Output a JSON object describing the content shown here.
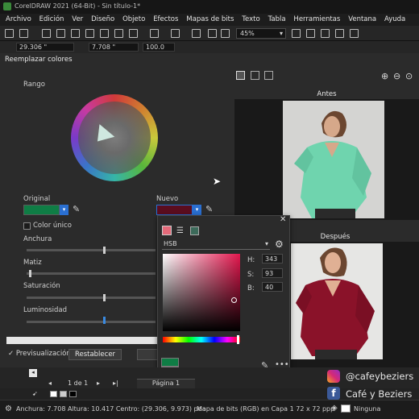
{
  "app": {
    "title": "CorelDRAW 2021 (64-Bit) - Sin título-1*"
  },
  "menu": [
    "Archivo",
    "Edición",
    "Ver",
    "Diseño",
    "Objeto",
    "Efectos",
    "Mapas de bits",
    "Texto",
    "Tabla",
    "Herramientas",
    "Ventana",
    "Ayuda"
  ],
  "toolbar": {
    "zoom": "45%"
  },
  "propbar": {
    "x": "29.306 \"",
    "y": "7.708 \"",
    "scale": "100.0"
  },
  "dialog": {
    "title": "Reemplazar colores",
    "range_label": "Rango",
    "original_label": "Original",
    "new_label": "Nuevo",
    "single_color_label": "Color único",
    "width_label": "Anchura",
    "hue_label": "Matiz",
    "saturation_label": "Saturación",
    "luminosity_label": "Luminosidad",
    "preview_label": "Previsualización",
    "reset_label": "Restablecer",
    "before_label": "Antes",
    "after_label": "Después",
    "original_color": "#0f7d45",
    "new_color": "#5b0d1f"
  },
  "color_popup": {
    "model": "HSB",
    "h_label": "H:",
    "h_value": "343",
    "s_label": "S:",
    "s_value": "93",
    "b_label": "B:",
    "b_value": "40"
  },
  "pages": {
    "counter": "1 de 1",
    "tab": "Página 1"
  },
  "status": {
    "dimensions": "Anchura: 7.708 Altura: 10.417 Centro: (29.306, 9.973) pda",
    "object_info": "Mapa de bits (RGB) en Capa 1 72 x 72 ppp",
    "fill": "Ninguna"
  },
  "social": {
    "instagram": "@cafeybeziers",
    "facebook": "Café y Beziers"
  }
}
